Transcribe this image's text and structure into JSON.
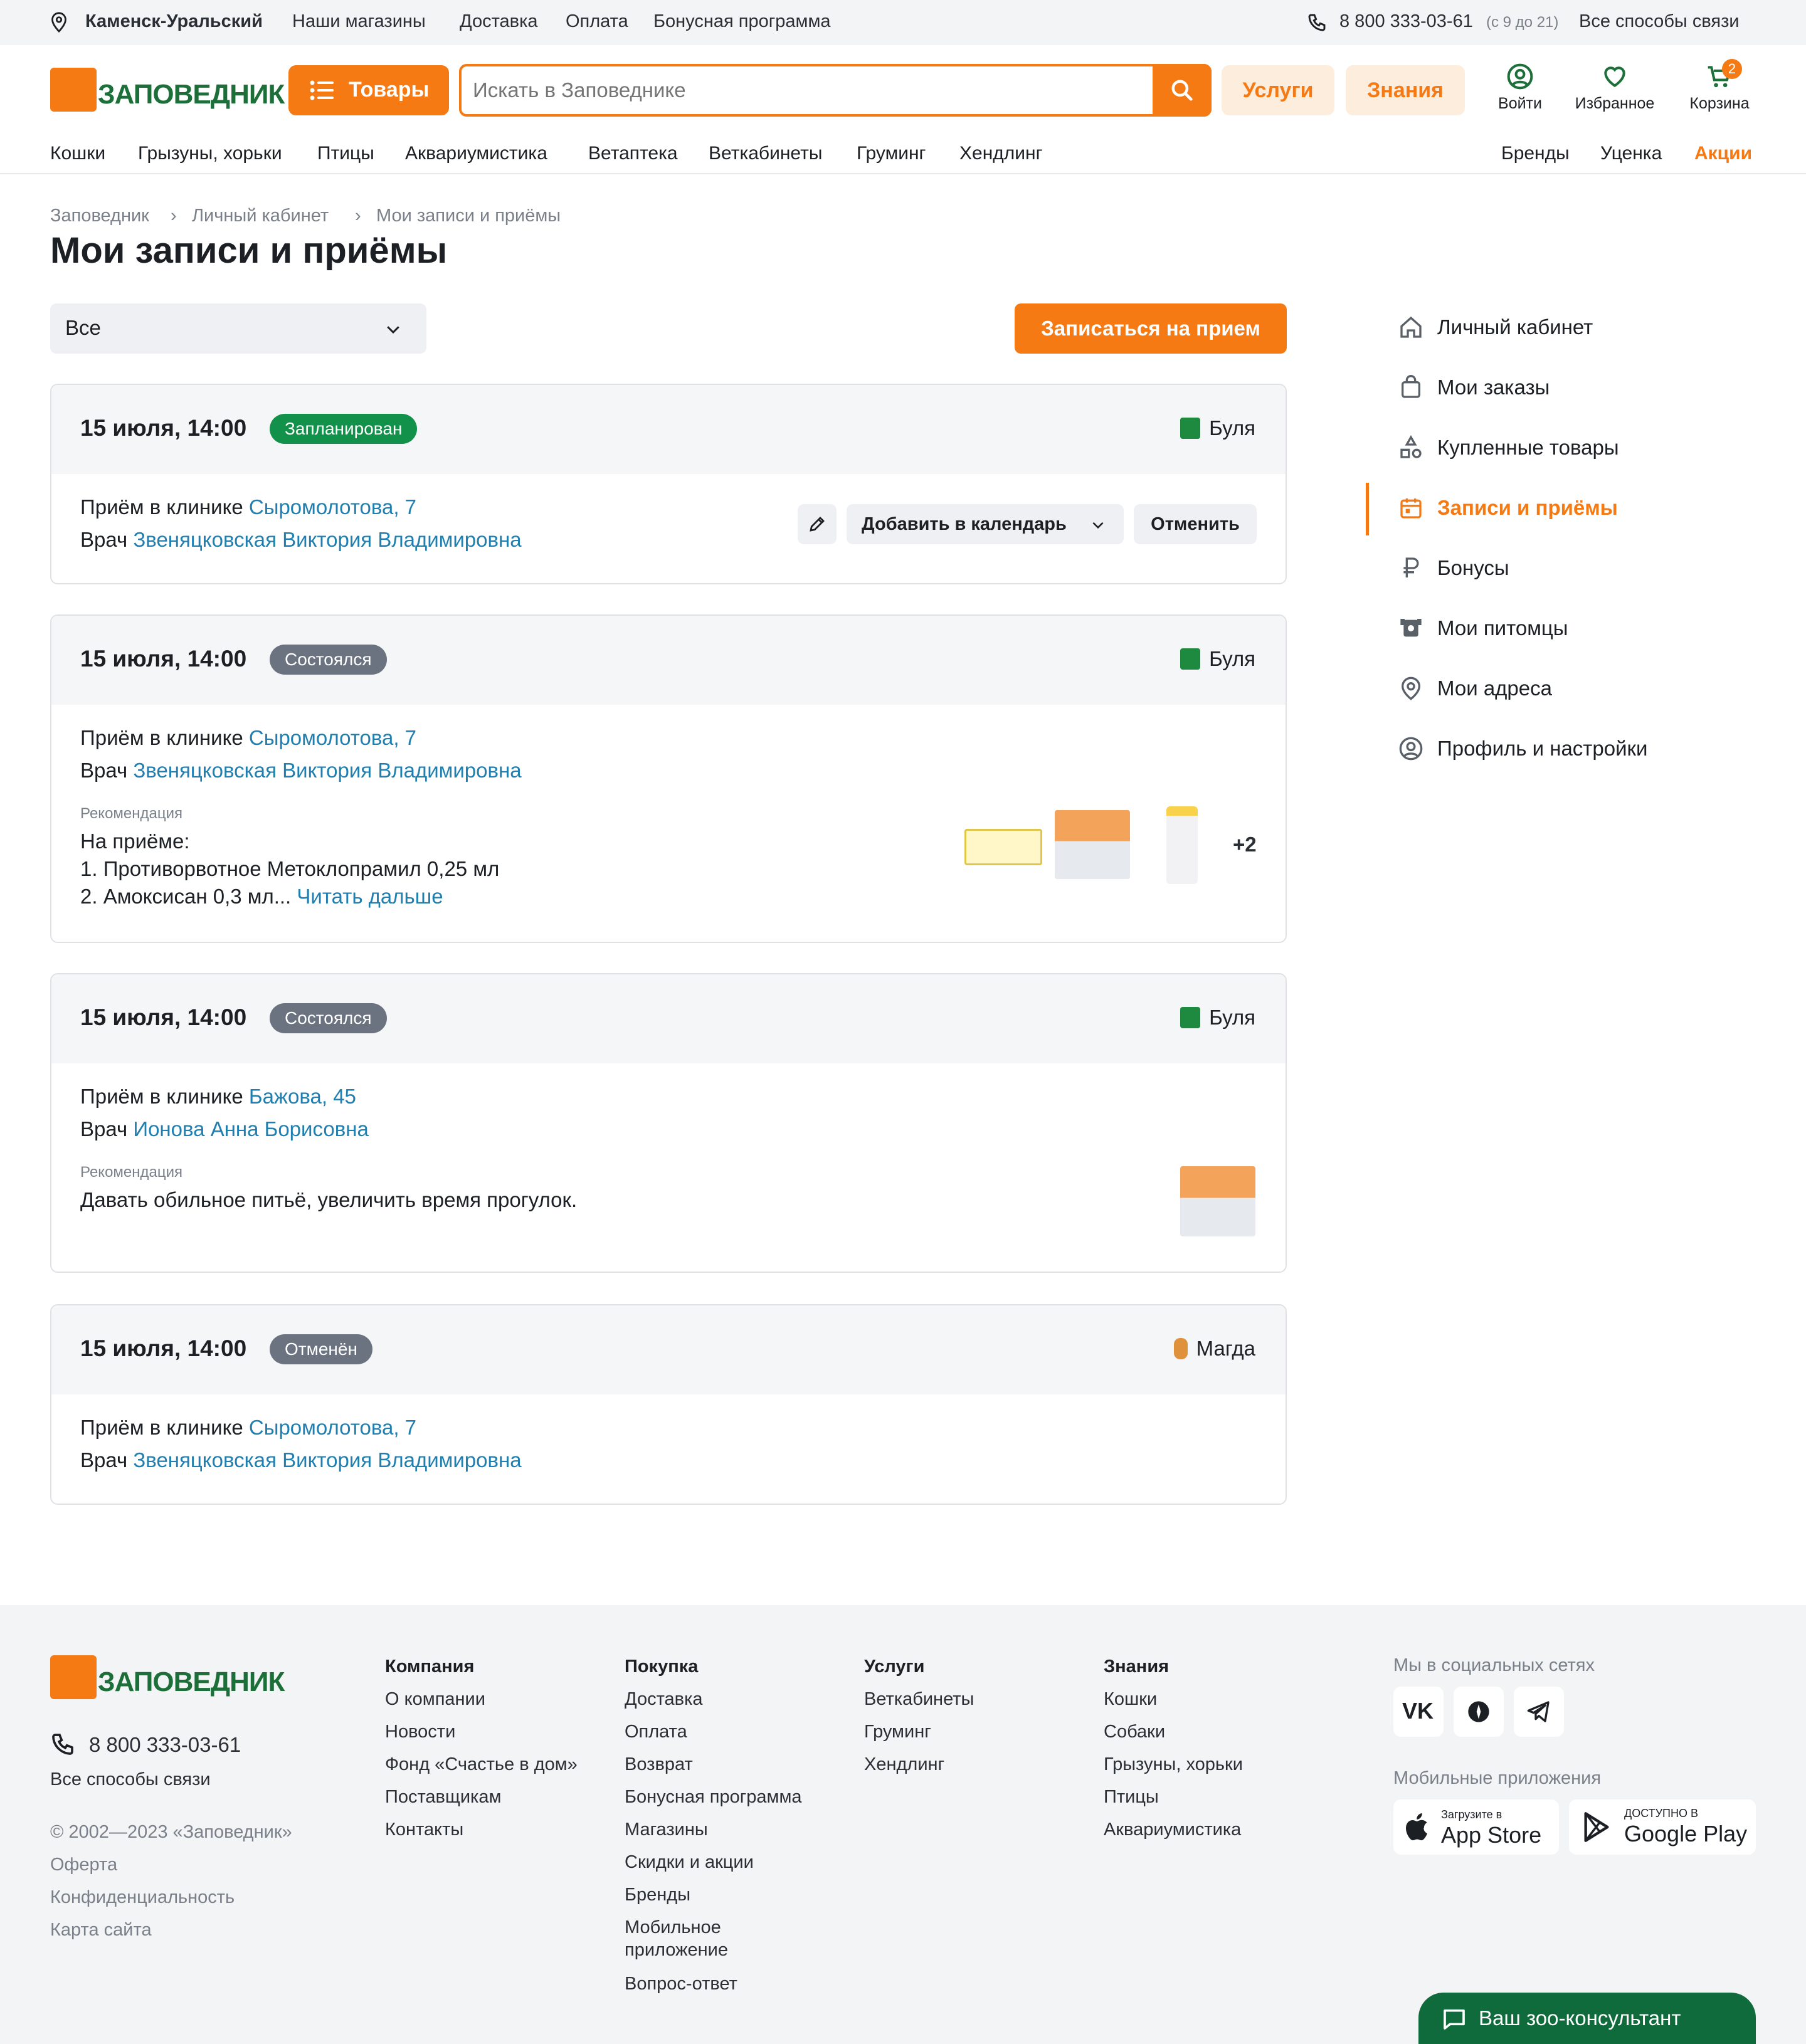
{
  "topbar": {
    "city": "Каменск-Уральский",
    "links": [
      "Наши магазины",
      "Доставка",
      "Оплата",
      "Бонусная программа"
    ],
    "phone": "8 800 333-03-61",
    "hours": "(с 9 до 21)",
    "contacts": "Все способы связи"
  },
  "header": {
    "logo": "ЗАПОВЕДНИК",
    "goods_button": "Товары",
    "search_placeholder": "Искать в Заповеднике",
    "services_button": "Услуги",
    "knowledge_button": "Знания",
    "login": "Войти",
    "favorites": "Избранное",
    "cart": "Корзина",
    "cart_count": "2"
  },
  "nav": {
    "left": [
      "Кошки",
      "Грызуны, хорьки",
      "Птицы",
      "Аквариумистика",
      "Ветаптека",
      "Веткабинеты",
      "Груминг",
      "Хендлинг"
    ],
    "right": [
      "Бренды",
      "Уценка",
      "Акции"
    ]
  },
  "breadcrumbs": [
    "Заповедник",
    "Личный кабинет",
    "Мои записи и приёмы"
  ],
  "page_title": "Мои записи и приёмы",
  "filter": {
    "value": "Все"
  },
  "book_button": "Записаться на прием",
  "labels": {
    "clinic": "Приём в клинике",
    "doctor": "Врач",
    "recommendation": "Рекомендация",
    "read_more": "Читать дальше",
    "add_calendar": "Добавить в календарь",
    "cancel": "Отменить"
  },
  "appointments": [
    {
      "date": "15 июля, 14:00",
      "status": "Запланирован",
      "status_color": "#12914a",
      "pet": "Буля",
      "clinic": "Сыромолотова, 7",
      "doctor": "Звеняцковская Виктория Владимировна"
    },
    {
      "date": "15 июля, 14:00",
      "status": "Состоялся",
      "status_color": "#6b7280",
      "pet": "Буля",
      "clinic": "Сыромолотова, 7",
      "doctor": "Звеняцковская Виктория Владимировна",
      "rec_lines": [
        "На приёме:",
        "1. Противорвотное Метоклопрамил 0,25 мл",
        "2. Амоксисан 0,3 мл..."
      ],
      "more_products": "+2"
    },
    {
      "date": "15 июля, 14:00",
      "status": "Состоялся",
      "status_color": "#6b7280",
      "pet": "Буля",
      "clinic": "Бажова, 45",
      "doctor": "Ионова Анна Борисовна",
      "rec_lines": [
        "Давать обильное питьё, увеличить время прогулок."
      ]
    },
    {
      "date": "15 июля, 14:00",
      "status": "Отменён",
      "status_color": "#6b7280",
      "pet": "Магда",
      "clinic": "Сыромолотова, 7",
      "doctor": "Звеняцковская Виктория Владимировна"
    }
  ],
  "side_menu": [
    {
      "label": "Личный кабинет",
      "icon": "home-icon"
    },
    {
      "label": "Мои заказы",
      "icon": "bag-icon"
    },
    {
      "label": "Купленные товары",
      "icon": "shapes-icon"
    },
    {
      "label": "Записи и приёмы",
      "icon": "calendar-icon",
      "active": true
    },
    {
      "label": "Бонусы",
      "icon": "ruble-icon"
    },
    {
      "label": "Мои питомцы",
      "icon": "pet-icon"
    },
    {
      "label": "Мои адреса",
      "icon": "pin-icon"
    },
    {
      "label": "Профиль и настройки",
      "icon": "profile-icon"
    }
  ],
  "footer": {
    "logo": "ЗАПОВЕДНИК",
    "phone": "8 800 333-03-61",
    "contacts": "Все способы связи",
    "copyright": "© 2002—2023 «Заповедник»",
    "legal": [
      "Оферта",
      "Конфиденциальность",
      "Карта сайта"
    ],
    "columns": [
      {
        "title": "Компания",
        "links": [
          "О компании",
          "Новости",
          "Фонд «Счастье в дом»",
          "Поставщикам",
          "Контакты"
        ]
      },
      {
        "title": "Покупка",
        "links": [
          "Доставка",
          "Оплата",
          "Возврат",
          "Бонусная программа",
          "Магазины",
          "Скидки и акции",
          "Бренды",
          "Мобильное",
          "приложение",
          "Вопрос-ответ"
        ]
      },
      {
        "title": "Услуги",
        "links": [
          "Веткабинеты",
          "Груминг",
          "Хендлинг"
        ]
      },
      {
        "title": "Знания",
        "links": [
          "Кошки",
          "Собаки",
          "Грызуны, хорьки",
          "Птицы",
          "Аквариумистика"
        ]
      }
    ],
    "social_title": "Мы в социальных сетях",
    "apps_title": "Мобильные приложения",
    "appstore_small": "Загрузите в",
    "appstore": "App Store",
    "gplay_small": "ДОСТУПНО В",
    "gplay": "Google Play"
  },
  "consultant": "Ваш зоо-консультант",
  "colors": {
    "accent": "#f57a14",
    "brand_green": "#1d6f39",
    "link": "#1f7fb0"
  }
}
